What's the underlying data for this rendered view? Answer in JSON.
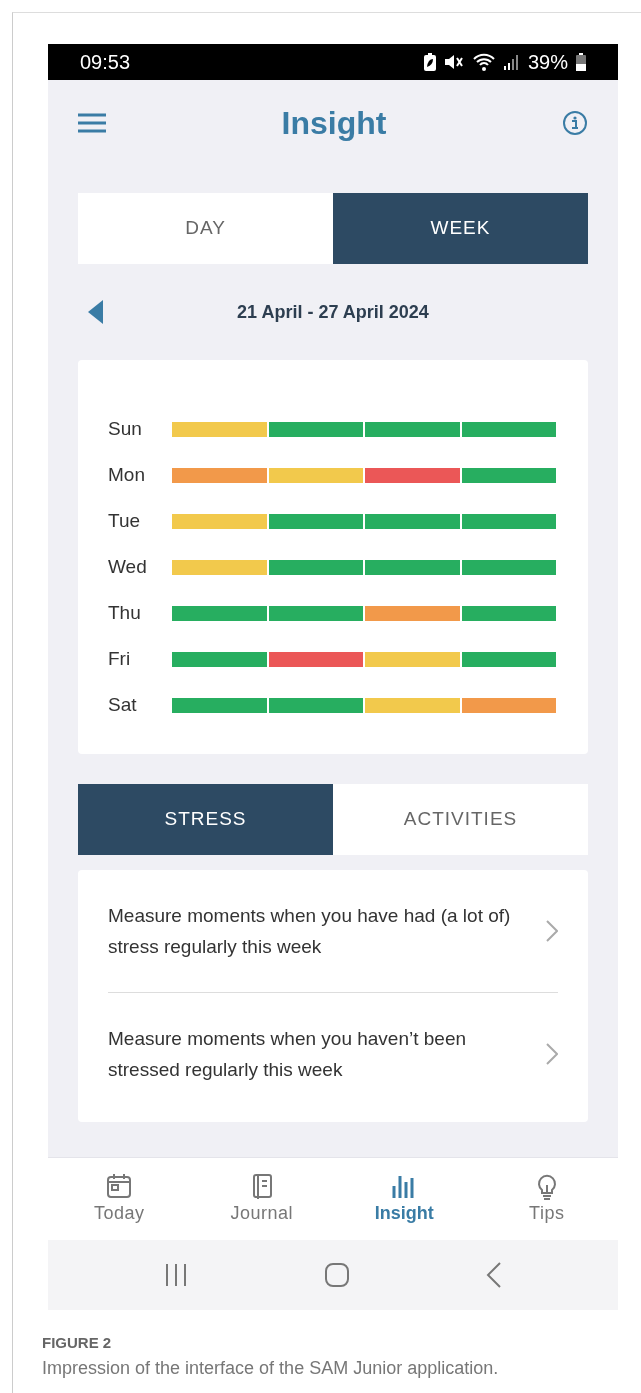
{
  "status_bar": {
    "time": "09:53",
    "battery": "39%"
  },
  "header": {
    "title": "Insight"
  },
  "period_tabs": [
    {
      "label": "DAY",
      "selected": false
    },
    {
      "label": "WEEK",
      "selected": true
    }
  ],
  "date_range": "21 April - 27 April 2024",
  "week_grid": [
    {
      "day": "Sun",
      "segments": [
        {
          "color": "#f2c94c"
        },
        {
          "color": "#27ae60"
        },
        {
          "color": "#27ae60"
        },
        {
          "color": "#27ae60"
        }
      ]
    },
    {
      "day": "Mon",
      "segments": [
        {
          "color": "#f2994a"
        },
        {
          "color": "#f2c94c"
        },
        {
          "color": "#eb5757"
        },
        {
          "color": "#27ae60"
        }
      ]
    },
    {
      "day": "Tue",
      "segments": [
        {
          "color": "#f2c94c"
        },
        {
          "color": "#27ae60"
        },
        {
          "color": "#27ae60"
        },
        {
          "color": "#27ae60"
        }
      ]
    },
    {
      "day": "Wed",
      "segments": [
        {
          "color": "#f2c94c"
        },
        {
          "color": "#27ae60"
        },
        {
          "color": "#27ae60"
        },
        {
          "color": "#27ae60"
        }
      ]
    },
    {
      "day": "Thu",
      "segments": [
        {
          "color": "#27ae60"
        },
        {
          "color": "#27ae60"
        },
        {
          "color": "#f2994a"
        },
        {
          "color": "#27ae60"
        }
      ]
    },
    {
      "day": "Fri",
      "segments": [
        {
          "color": "#27ae60"
        },
        {
          "color": "#eb5757"
        },
        {
          "color": "#f2c94c"
        },
        {
          "color": "#27ae60"
        }
      ]
    },
    {
      "day": "Sat",
      "segments": [
        {
          "color": "#27ae60"
        },
        {
          "color": "#27ae60"
        },
        {
          "color": "#f2c94c"
        },
        {
          "color": "#f2994a"
        }
      ]
    }
  ],
  "topic_tabs": [
    {
      "label": "STRESS",
      "selected": true
    },
    {
      "label": "ACTIVITIES",
      "selected": false
    }
  ],
  "items": [
    {
      "text": "Measure moments when you have had (a lot of) stress regularly this week"
    },
    {
      "text": "Measure moments when you haven’t been stressed regularly this week"
    }
  ],
  "bottom_nav": [
    {
      "label": "Today",
      "kind": "calendar",
      "selected": false
    },
    {
      "label": "Journal",
      "kind": "journal",
      "selected": false
    },
    {
      "label": "Insight",
      "kind": "chart",
      "selected": true
    },
    {
      "label": "Tips",
      "kind": "bulb",
      "selected": false
    }
  ],
  "caption": {
    "label": "FIGURE 2",
    "text": "Impression of the interface of the SAM Junior application."
  }
}
